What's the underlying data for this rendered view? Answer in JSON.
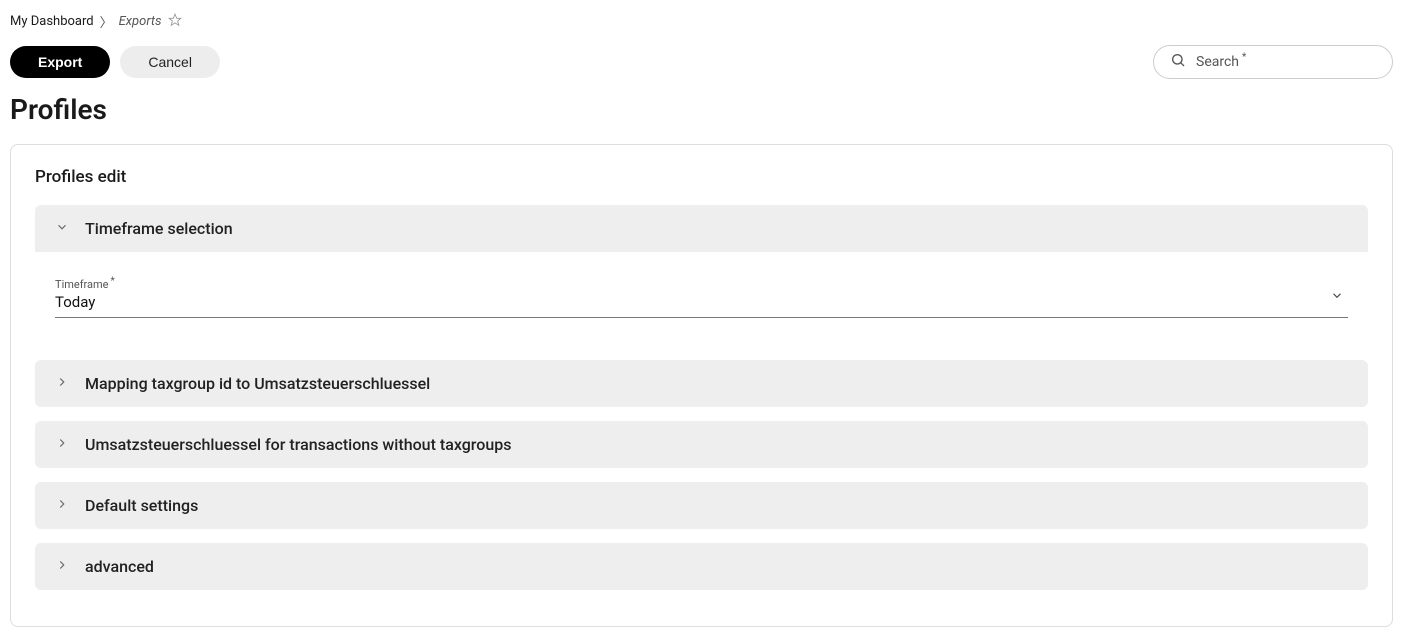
{
  "breadcrumb": {
    "root": "My Dashboard",
    "current": "Exports"
  },
  "toolbar": {
    "export_label": "Export",
    "cancel_label": "Cancel",
    "search_placeholder": "Search"
  },
  "page": {
    "title": "Profiles",
    "card_title": "Profiles edit"
  },
  "sections": {
    "timeframe": {
      "title": "Timeframe selection",
      "field_label": "Timeframe",
      "field_value": "Today"
    },
    "mapping": {
      "title": "Mapping taxgroup id to Umsatzsteuerschluessel"
    },
    "umsatz": {
      "title": "Umsatzsteuerschluessel for transactions without taxgroups"
    },
    "defaults": {
      "title": "Default settings"
    },
    "advanced": {
      "title": "advanced"
    }
  }
}
